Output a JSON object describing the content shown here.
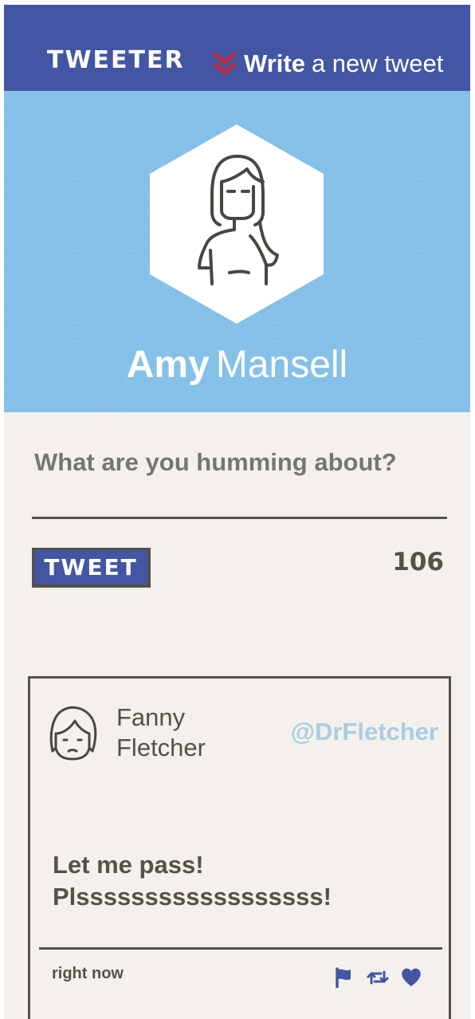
{
  "nav": {
    "brand": "TWEETER",
    "write_strong": "Write",
    "write_rest": "a new tweet",
    "write_icon": "double-chevron-down-icon",
    "colors": {
      "bar": "#4356a3",
      "chevron": "#c3253c"
    }
  },
  "profile": {
    "first_name": "Amy",
    "last_name": "Mansell",
    "avatar_icon": "woman-avatar-icon",
    "hero_color": "#84c0e8"
  },
  "composer": {
    "placeholder": "What are you humming about?",
    "value": "",
    "tweet_button_label": "TWEET",
    "char_count": "106"
  },
  "tweets": [
    {
      "display_name": "Fanny Fletcher",
      "handle": "@DrFletcher",
      "text": "Let me pass! Plssssssssssssssssss!",
      "timestamp": "right now",
      "avatar_icon": "girl-face-avatar-icon",
      "actions": [
        "flag-icon",
        "retweet-icon",
        "heart-icon"
      ]
    }
  ]
}
